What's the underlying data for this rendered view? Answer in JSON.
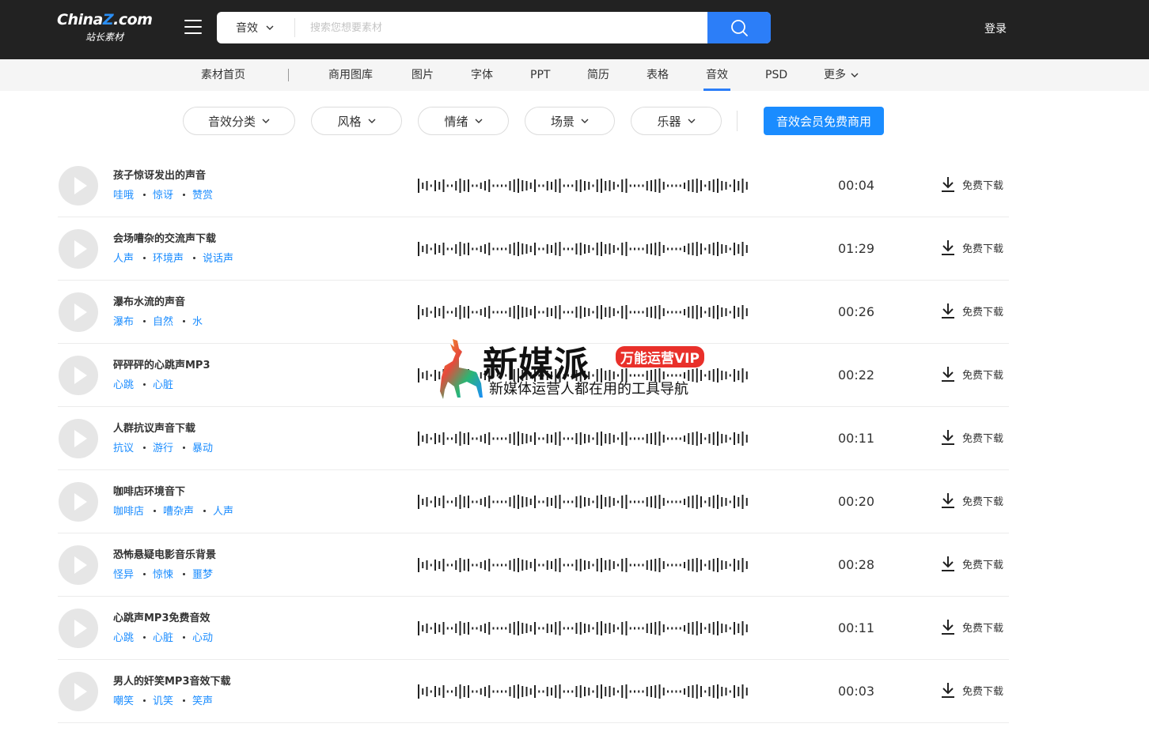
{
  "header": {
    "logo_text_pre": "China",
    "logo_text_z": "Z",
    "logo_text_post": ".com",
    "logo_subtitle": "站长素材",
    "search_category": "音效",
    "search_placeholder": "搜索您想要素材",
    "login_label": "登录"
  },
  "nav": {
    "items": [
      "素材首页",
      "商用图库",
      "图片",
      "字体",
      "PPT",
      "简历",
      "表格",
      "音效",
      "PSD",
      "更多"
    ],
    "active": "音效"
  },
  "filters": {
    "items": [
      "音效分类",
      "风格",
      "情绪",
      "场景",
      "乐器"
    ],
    "vip_button": "音效会员免费商用"
  },
  "list": {
    "download_label": "免费下载",
    "rows": [
      {
        "title": "孩子惊讶发出的声音",
        "tags": [
          "哇哦",
          "惊讶",
          "赞赏"
        ],
        "duration": "00:04"
      },
      {
        "title": "会场嘈杂的交流声下载",
        "tags": [
          "人声",
          "环境声",
          "说话声"
        ],
        "duration": "01:29"
      },
      {
        "title": "瀑布水流的声音",
        "tags": [
          "瀑布",
          "自然",
          "水"
        ],
        "duration": "00:26"
      },
      {
        "title": "砰砰砰的心跳声MP3",
        "tags": [
          "心跳",
          "心脏"
        ],
        "duration": "00:22"
      },
      {
        "title": "人群抗议声音下载",
        "tags": [
          "抗议",
          "游行",
          "暴动"
        ],
        "duration": "00:11"
      },
      {
        "title": "咖啡店环境音下",
        "tags": [
          "咖啡店",
          "嘈杂声",
          "人声"
        ],
        "duration": "00:20"
      },
      {
        "title": "恐怖悬疑电影音乐背景",
        "tags": [
          "怪异",
          "惊悚",
          "噩梦"
        ],
        "duration": "00:28"
      },
      {
        "title": "心跳声MP3免费音效",
        "tags": [
          "心跳",
          "心脏",
          "心动"
        ],
        "duration": "00:11"
      },
      {
        "title": "男人的奸笑MP3音效下载",
        "tags": [
          "嘲笑",
          "讥笑",
          "笑声"
        ],
        "duration": "00:03"
      }
    ]
  },
  "watermark": {
    "title": "新媒派",
    "badge": "万能运营VIP",
    "subtitle": "新媒体运营人都在用的工具导航"
  },
  "colors": {
    "header_bg": "#222222",
    "accent": "#2c7ef8",
    "tag_blue": "#1a8cff",
    "nav_bg": "#f5f5f5"
  }
}
